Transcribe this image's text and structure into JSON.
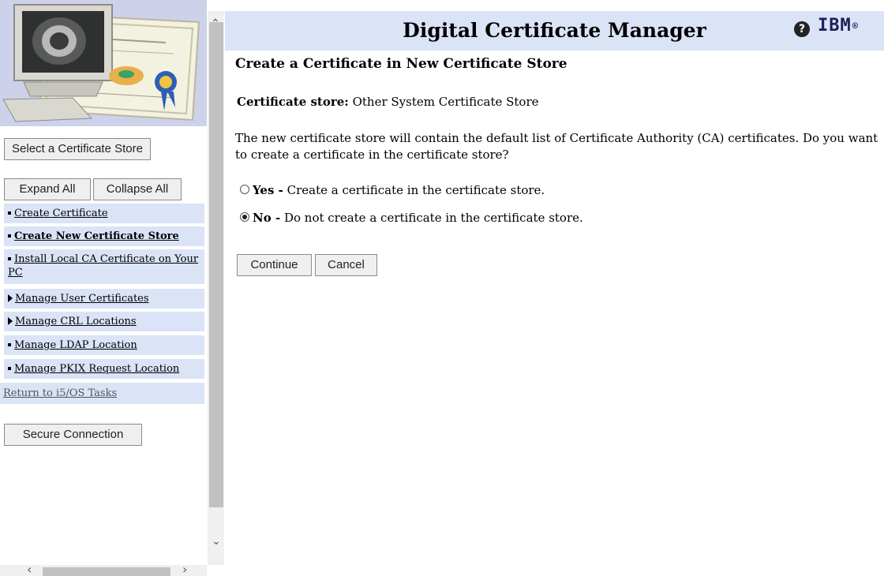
{
  "window": {
    "title": "Digital Certificate Manager"
  },
  "sidebar": {
    "select_store_label": "Select a Certificate Store",
    "expand_all_label": "Expand All",
    "collapse_all_label": "Collapse All",
    "items": [
      {
        "label": "Create Certificate",
        "marker": "square-bullet",
        "current": false
      },
      {
        "label": "Create New Certificate Store",
        "marker": "square-bullet",
        "current": true
      },
      {
        "label": "Install Local CA Certificate on Your PC",
        "marker": "square-bullet",
        "current": false
      },
      {
        "label": "Manage User Certificates",
        "marker": "expand-triangle",
        "current": false
      },
      {
        "label": "Manage CRL Locations",
        "marker": "expand-triangle",
        "current": false
      },
      {
        "label": "Manage LDAP Location",
        "marker": "square-bullet",
        "current": false
      },
      {
        "label": "Manage PKIX Request Location",
        "marker": "square-bullet",
        "current": false
      }
    ],
    "return_link": "Return to i5/OS Tasks",
    "secure_connection_label": "Secure Connection"
  },
  "header": {
    "title": "Digital Certificate Manager",
    "help_icon": "question-circle-icon",
    "brand": "IBM",
    "brand_mark": "®",
    "background": "#dbe3f7"
  },
  "main": {
    "page_title": "Create a Certificate in New Certificate Store",
    "store_label": "Certificate store:",
    "store_value": "Other System Certificate Store",
    "intro": "The new certificate store will contain the default list of Certificate Authority (CA) certificates. Do you want to create a certificate in the certificate store?",
    "options": [
      {
        "label": "Yes -",
        "description": "Create a certificate in the certificate store.",
        "selected": false
      },
      {
        "label": "No -",
        "description": "Do not create a certificate in the certificate store.",
        "selected": true
      }
    ],
    "continue_label": "Continue",
    "cancel_label": "Cancel"
  }
}
